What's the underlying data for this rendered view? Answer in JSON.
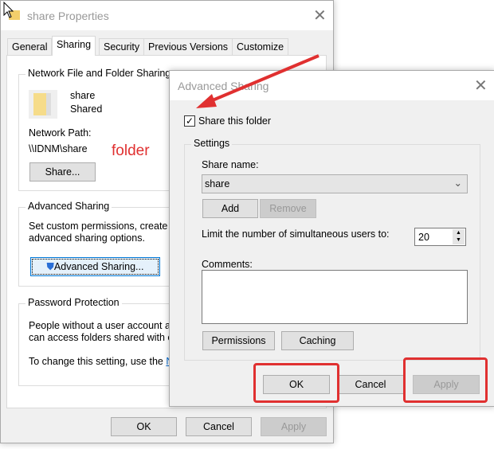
{
  "back_window": {
    "title": "share Properties",
    "tabs": [
      {
        "label": "General"
      },
      {
        "label": "Sharing",
        "selected": true
      },
      {
        "label": "Security"
      },
      {
        "label": "Previous Versions"
      },
      {
        "label": "Customize"
      }
    ],
    "network_group": {
      "label": "Network File and Folder Sharing",
      "folder_name": "share",
      "folder_status": "Shared",
      "path_label": "Network Path:",
      "path": "\\\\IDNM\\share",
      "share_button": "Share..."
    },
    "advanced_group": {
      "label": "Advanced Sharing",
      "text_1": "Set custom permissions, create m",
      "text_2": "advanced sharing options.",
      "button": "Advanced Sharing..."
    },
    "password_group": {
      "label": "Password Protection",
      "text_1": "People without a user account a",
      "text_2": "can access folders shared with e",
      "text_3": "To change this setting, use the ",
      "link": "N"
    },
    "buttons": {
      "ok": "OK",
      "cancel": "Cancel",
      "apply": "Apply"
    }
  },
  "annotation": {
    "label": "folder",
    "color": "#e03030"
  },
  "dialog": {
    "title": "Advanced Sharing",
    "share_checkbox": {
      "label": "Share this folder",
      "checked": true
    },
    "settings": {
      "label": "Settings",
      "share_name_label": "Share name:",
      "share_name_value": "share",
      "add": "Add",
      "remove": "Remove",
      "limit_label": "Limit the number of simultaneous users to:",
      "limit_value": "20",
      "comments_label": "Comments:",
      "comments_value": "",
      "permissions": "Permissions",
      "caching": "Caching"
    },
    "buttons": {
      "ok": "OK",
      "cancel": "Cancel",
      "apply": "Apply"
    }
  }
}
